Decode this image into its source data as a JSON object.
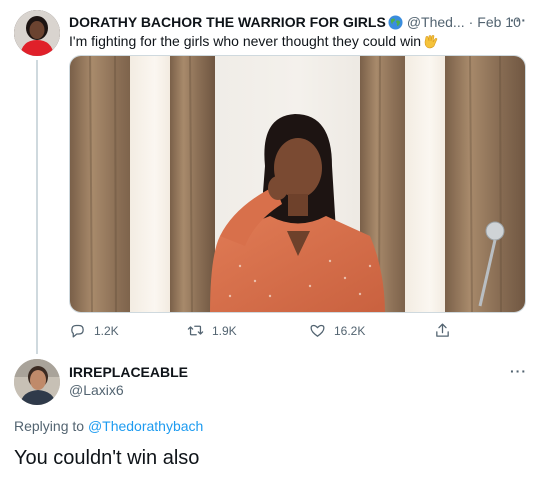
{
  "tweet": {
    "author_name": "DORATHY BACHOR THE WARRIOR FOR GIRLS",
    "author_handle": "@Thed...",
    "separator": "·",
    "date": "Feb 10",
    "more_label": "···",
    "text": "I'm fighting for the girls who never thought they could win",
    "emoji_icon": "raising-hands-emoji",
    "badge_icon": "globe-emoji",
    "media_description_icon": "photo",
    "actions": {
      "reply_count": "1.2K",
      "retweet_count": "1.9K",
      "like_count": "16.2K"
    }
  },
  "reply": {
    "author_name": "IRREPLACEABLE",
    "author_handle": "@Laxix6",
    "more_label": "···",
    "replying_prefix": "Replying to",
    "replying_mention": "@Thedorathybach",
    "text": "You couldn't win also"
  },
  "colors": {
    "text": "#0f1419",
    "secondary": "#536471",
    "link": "#1d9bf0",
    "border": "#cfd9de"
  }
}
